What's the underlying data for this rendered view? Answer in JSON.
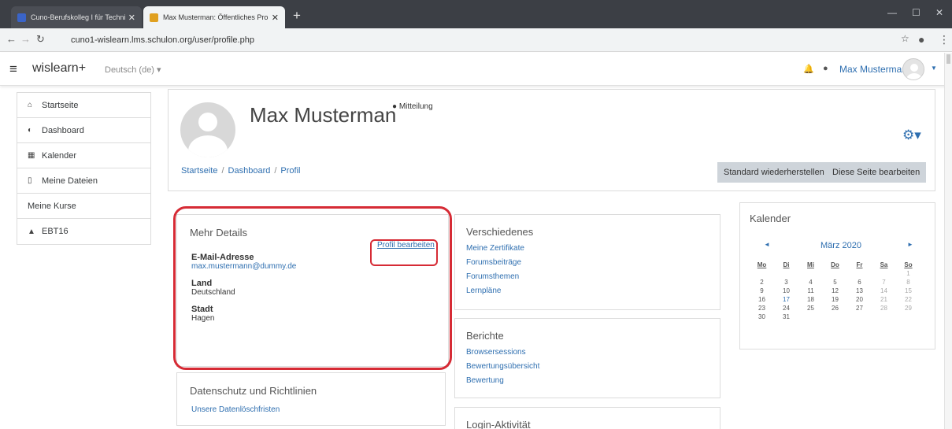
{
  "browser": {
    "tabs": [
      {
        "title": "Cuno-Berufskolleg I für Technik",
        "active": false,
        "favicon_color": "#3a64c8"
      },
      {
        "title": "Max Musterman: Öffentliches Pro",
        "active": true,
        "favicon_color": "#e0a020"
      }
    ],
    "url": "cuno1-wislearn.lms.schulon.org/user/profile.php"
  },
  "navbar": {
    "brand": "wislearn+",
    "language": "Deutsch (de)",
    "user_name": "Max Musterman"
  },
  "sidebar": {
    "items": [
      {
        "label": "Startseite",
        "icon": "home-icon",
        "glyph": "🏠"
      },
      {
        "label": "Dashboard",
        "icon": "dashboard-icon",
        "glyph": "⚙"
      },
      {
        "label": "Kalender",
        "icon": "calendar-icon",
        "glyph": "▦"
      },
      {
        "label": "Meine Dateien",
        "icon": "file-icon",
        "glyph": "🗋"
      },
      {
        "label": "Meine Kurse",
        "icon": "",
        "glyph": ""
      },
      {
        "label": "EBT16",
        "icon": "graduation-cap-icon",
        "glyph": "🎓"
      }
    ]
  },
  "profile": {
    "name": "Max Musterman",
    "message_link": "Mitteilung",
    "breadcrumb": [
      "Startseite",
      "Dashboard",
      "Profil"
    ],
    "reset_button": "Standard wiederherstellen",
    "edit_page_button": "Diese Seite bearbeiten"
  },
  "details": {
    "title": "Mehr Details",
    "edit_link": "Profil bearbeiten",
    "fields": [
      {
        "label": "E-Mail-Adresse",
        "value": "max.mustermann@dummy.de",
        "is_link": true
      },
      {
        "label": "Land",
        "value": "Deutschland",
        "is_link": false
      },
      {
        "label": "Stadt",
        "value": "Hagen",
        "is_link": false
      }
    ]
  },
  "privacy": {
    "title": "Datenschutz und Richtlinien",
    "links": [
      "Unsere Datenlöschfristen"
    ]
  },
  "misc": {
    "title": "Verschiedenes",
    "links": [
      "Meine Zertifikate",
      "Forumsbeiträge",
      "Forumsthemen",
      "Lernpläne"
    ]
  },
  "reports": {
    "title": "Berichte",
    "links": [
      "Browsersessions",
      "Bewertungsübersicht",
      "Bewertung"
    ]
  },
  "login": {
    "title": "Login-Aktivität"
  },
  "calendar": {
    "title": "Kalender",
    "month": "März 2020",
    "prev": "◄",
    "next": "►",
    "weekdays": [
      "Mo",
      "Di",
      "Mi",
      "Do",
      "Fr",
      "Sa",
      "So"
    ],
    "weeks": [
      [
        "",
        "",
        "",
        "",
        "",
        "",
        "1"
      ],
      [
        "2",
        "3",
        "4",
        "5",
        "6",
        "7",
        "8"
      ],
      [
        "9",
        "10",
        "11",
        "12",
        "13",
        "14",
        "15"
      ],
      [
        "16",
        "17",
        "18",
        "19",
        "20",
        "21",
        "22"
      ],
      [
        "23",
        "24",
        "25",
        "26",
        "27",
        "28",
        "29"
      ],
      [
        "30",
        "31",
        "",
        "",
        "",
        "",
        ""
      ]
    ],
    "highlight_day": "17"
  },
  "colors": {
    "link": "#2f6fb0",
    "annotation": "#d62b35",
    "button": "#ced4da"
  }
}
